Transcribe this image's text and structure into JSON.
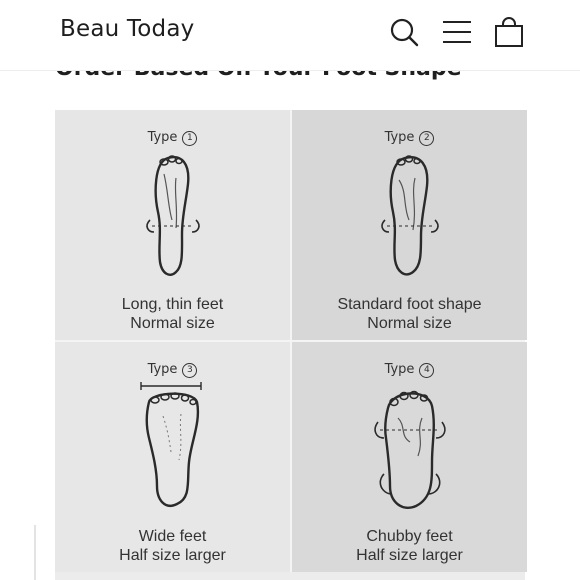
{
  "header": {
    "brand": "Beau Today",
    "icons": {
      "search": "search-icon",
      "menu": "menu-icon",
      "bag": "shopping-bag-icon"
    }
  },
  "section": {
    "heading": "Order Based On Your Foot Shape"
  },
  "size_guide": [
    {
      "type_label": "Type",
      "type_number": "1",
      "line1": "Long, thin feet",
      "line2": "Normal size"
    },
    {
      "type_label": "Type",
      "type_number": "2",
      "line1": "Standard foot shape",
      "line2": "Normal size"
    },
    {
      "type_label": "Type",
      "type_number": "3",
      "line1": "Wide feet",
      "line2": "Half size larger"
    },
    {
      "type_label": "Type",
      "type_number": "4",
      "line1": "Chubby feet",
      "line2": "Half size larger"
    }
  ]
}
